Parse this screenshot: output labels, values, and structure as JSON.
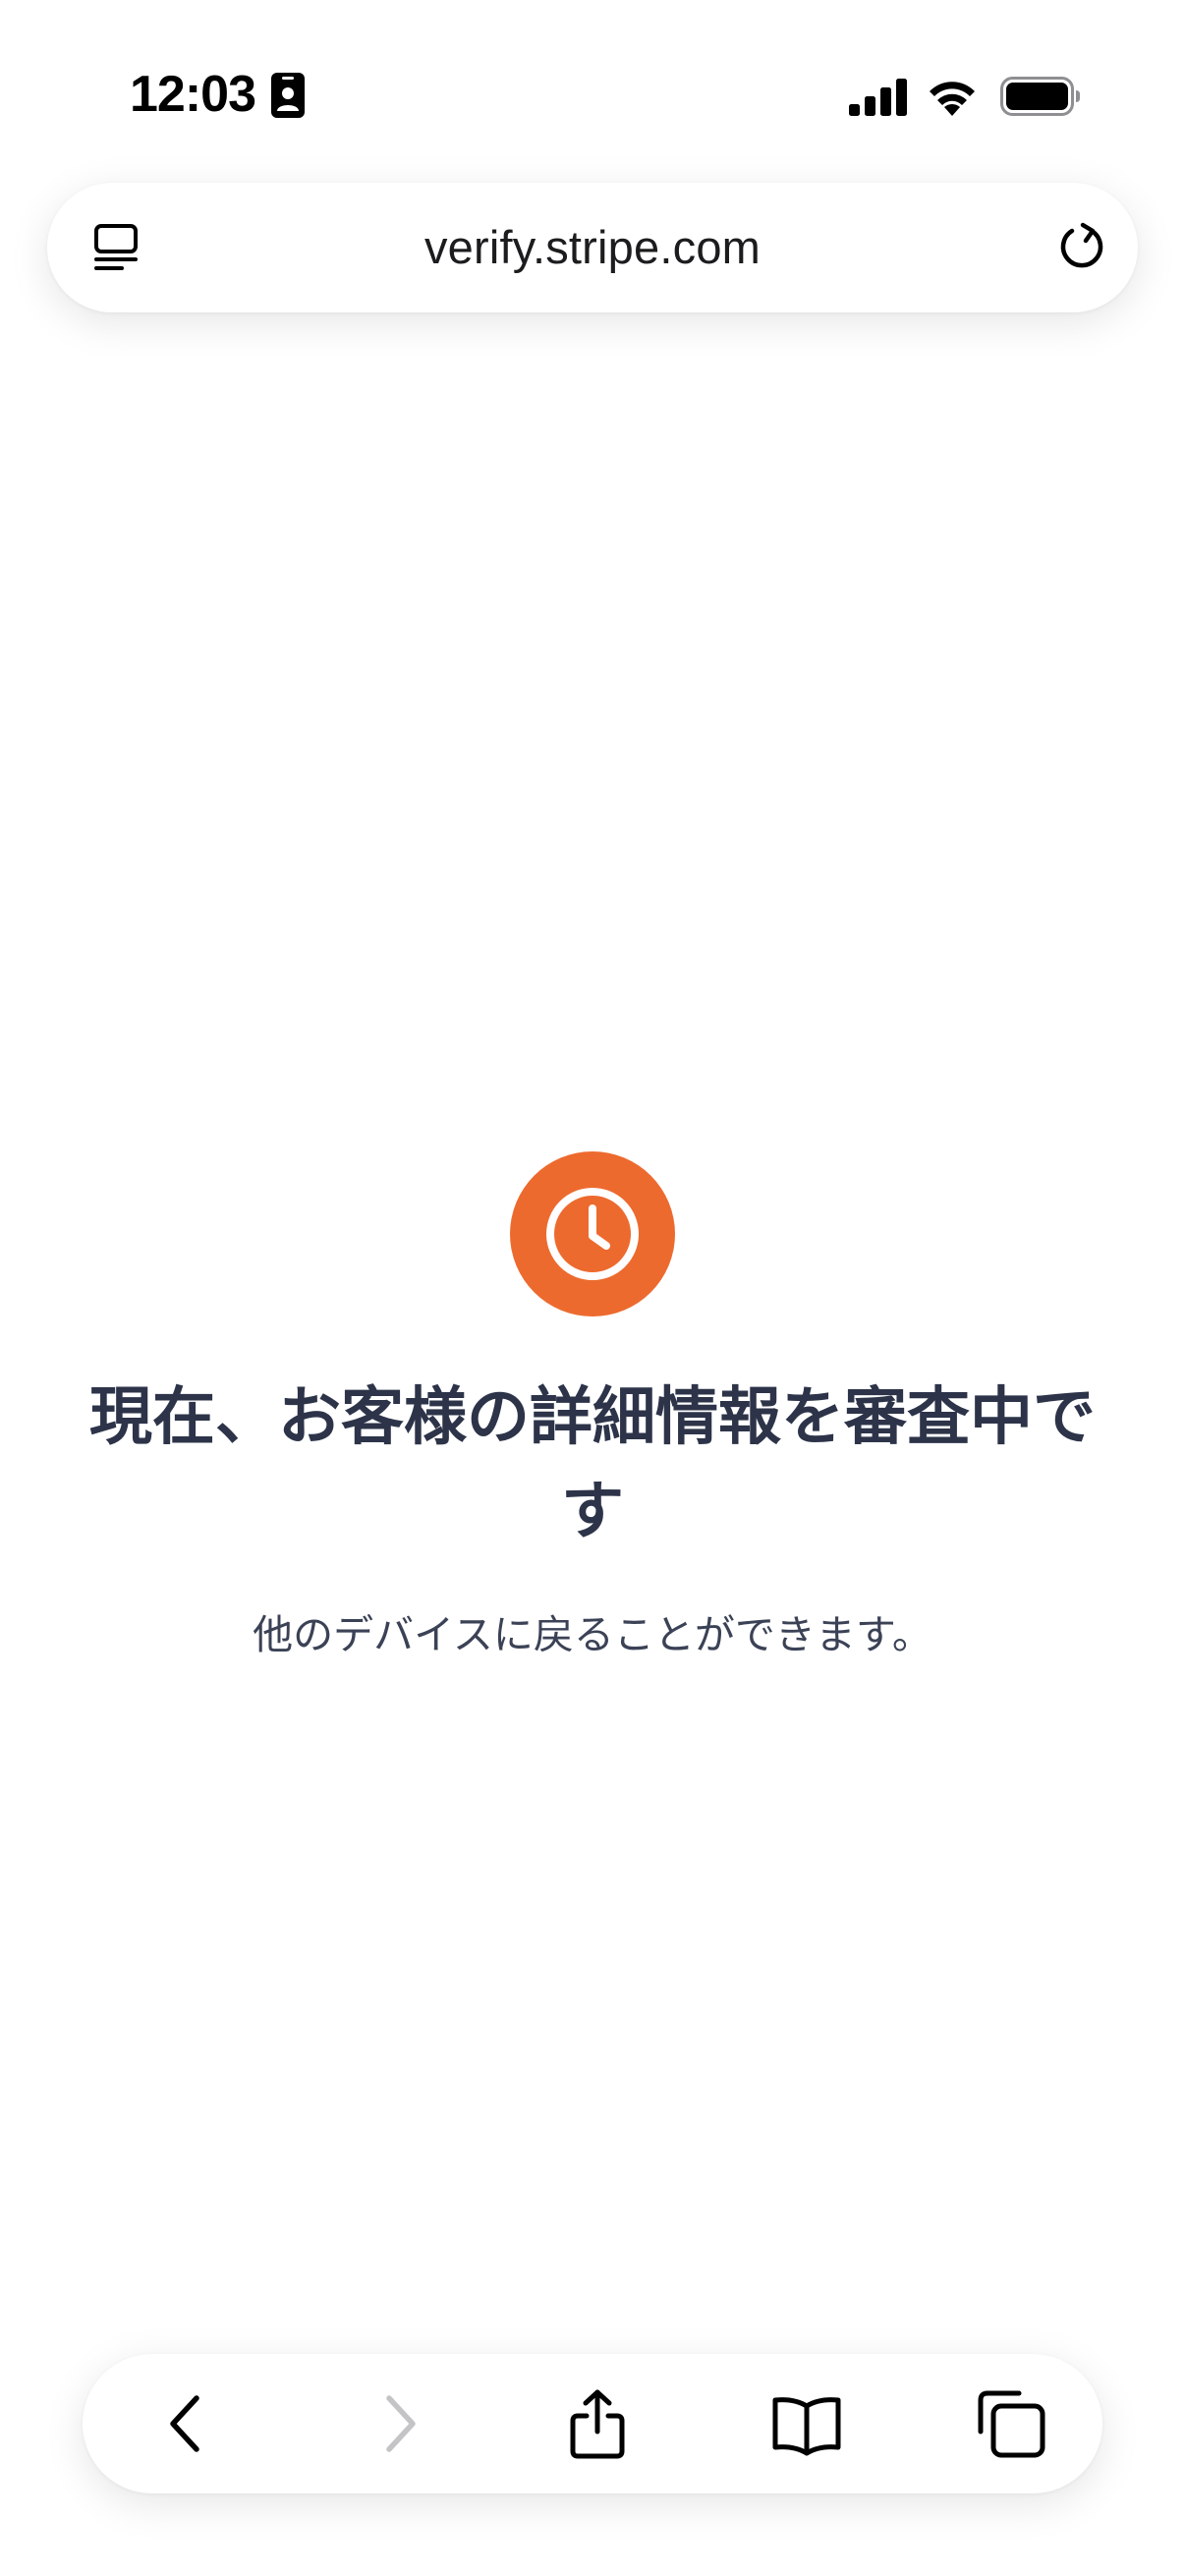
{
  "status_bar": {
    "time": "12:03",
    "icons": [
      "contact-card-icon",
      "cellular-signal-icon",
      "wifi-icon",
      "battery-icon"
    ]
  },
  "address_bar": {
    "url": "verify.stripe.com",
    "left_icon": "reader-mode-icon",
    "right_icon": "reload-icon"
  },
  "main": {
    "status_icon": "clock-icon",
    "title": "現在、お客様の詳細情報を審査中です",
    "subtitle": "他のデバイスに戻ることができます。"
  },
  "toolbar": {
    "items": [
      {
        "icon": "back-chevron-icon",
        "enabled": true
      },
      {
        "icon": "forward-chevron-icon",
        "enabled": false
      },
      {
        "icon": "share-icon",
        "enabled": true
      },
      {
        "icon": "bookmarks-book-icon",
        "enabled": true
      },
      {
        "icon": "tabs-icon",
        "enabled": true
      }
    ]
  },
  "colors": {
    "accent_orange": "#ed6a2e",
    "heading_text": "#2d3449",
    "body_text": "#3b4256",
    "disabled_icon": "#c4c4c6",
    "icon": "#000000"
  }
}
